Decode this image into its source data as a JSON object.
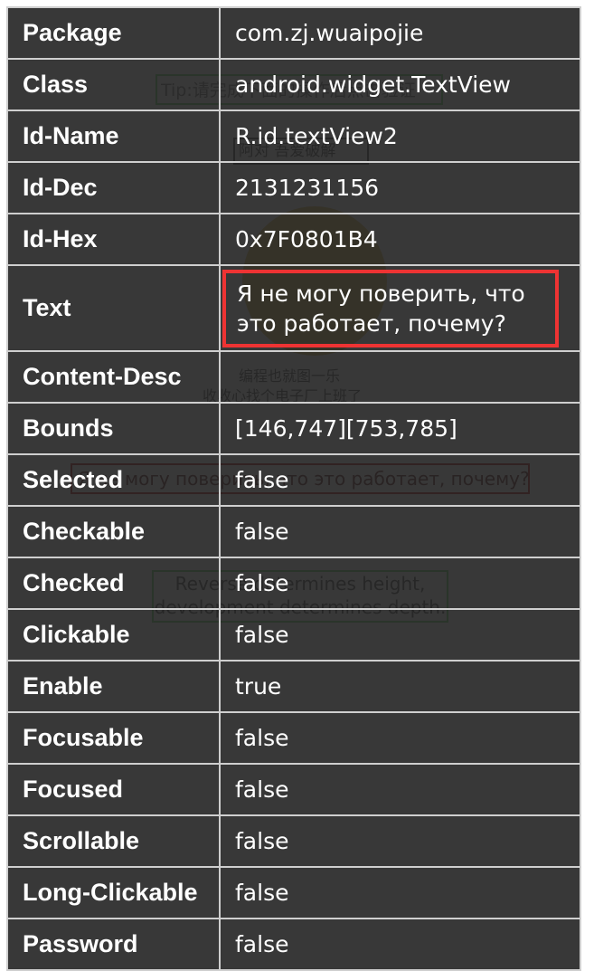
{
  "background": {
    "tip": "Tip:请完成下面的操作后点击验证",
    "author": "阿对 吾爱破解",
    "line1": "编程也就图一乐",
    "line2": "收收心找个电子厂上班了",
    "russian": "Я не могу поверить, что это работает, почему?",
    "reverse": "Reverse determines height, development determines depth."
  },
  "inspector": {
    "rows": [
      {
        "key": "Package",
        "value": "com.zj.wuaipojie"
      },
      {
        "key": "Class",
        "value": "android.widget.TextView"
      },
      {
        "key": "Id-Name",
        "value": "R.id.textView2"
      },
      {
        "key": "Id-Dec",
        "value": "2131231156"
      },
      {
        "key": "Id-Hex",
        "value": "0x7F0801B4"
      },
      {
        "key": "Text",
        "value": "Я не могу поверить, что это работает, почему?"
      },
      {
        "key": "Content-Desc",
        "value": ""
      },
      {
        "key": "Bounds",
        "value": "[146,747][753,785]"
      },
      {
        "key": "Selected",
        "value": "false"
      },
      {
        "key": "Checkable",
        "value": "false"
      },
      {
        "key": "Checked",
        "value": "false"
      },
      {
        "key": "Clickable",
        "value": "false"
      },
      {
        "key": "Enable",
        "value": "true"
      },
      {
        "key": "Focusable",
        "value": "false"
      },
      {
        "key": "Focused",
        "value": "false"
      },
      {
        "key": "Scrollable",
        "value": "false"
      },
      {
        "key": "Long-Clickable",
        "value": "false"
      },
      {
        "key": "Password",
        "value": "false"
      }
    ]
  },
  "colors": {
    "panel_bg": "#222222",
    "grid_line": "#cfcfcf",
    "highlight": "#ee3333",
    "text": "#ffffff"
  }
}
